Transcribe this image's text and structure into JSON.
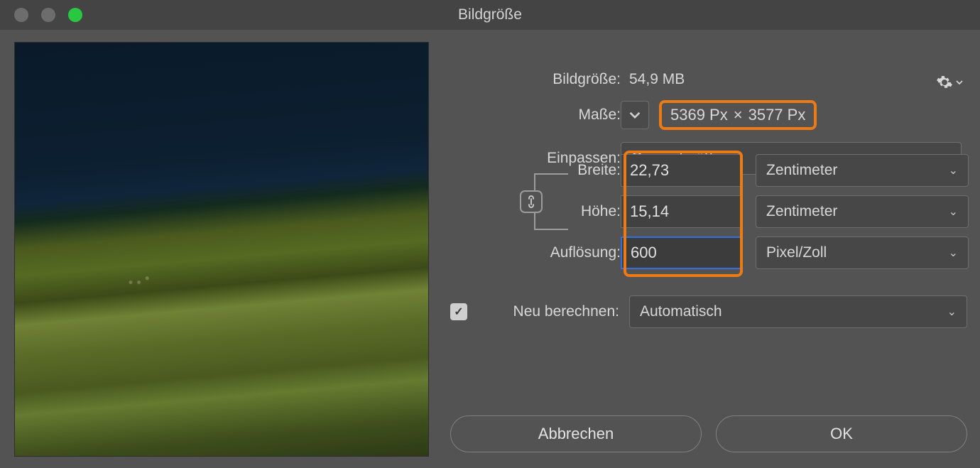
{
  "window": {
    "title": "Bildgröße"
  },
  "filesize": {
    "label": "Bildgröße:",
    "value": "54,9 MB"
  },
  "dimensions": {
    "label": "Maße:",
    "width_px": "5369 Px",
    "sep": "×",
    "height_px": "3577 Px"
  },
  "fit": {
    "label": "Einpassen:",
    "value": "Originalgröße"
  },
  "width": {
    "label": "Breite:",
    "value": "22,73",
    "unit": "Zentimeter"
  },
  "height": {
    "label": "Höhe:",
    "value": "15,14",
    "unit": "Zentimeter"
  },
  "resolution": {
    "label": "Auflösung:",
    "value": "600",
    "unit": "Pixel/Zoll"
  },
  "resample": {
    "label": "Neu berechnen:",
    "value": "Automatisch",
    "checked": true
  },
  "buttons": {
    "cancel": "Abbrechen",
    "ok": "OK"
  }
}
